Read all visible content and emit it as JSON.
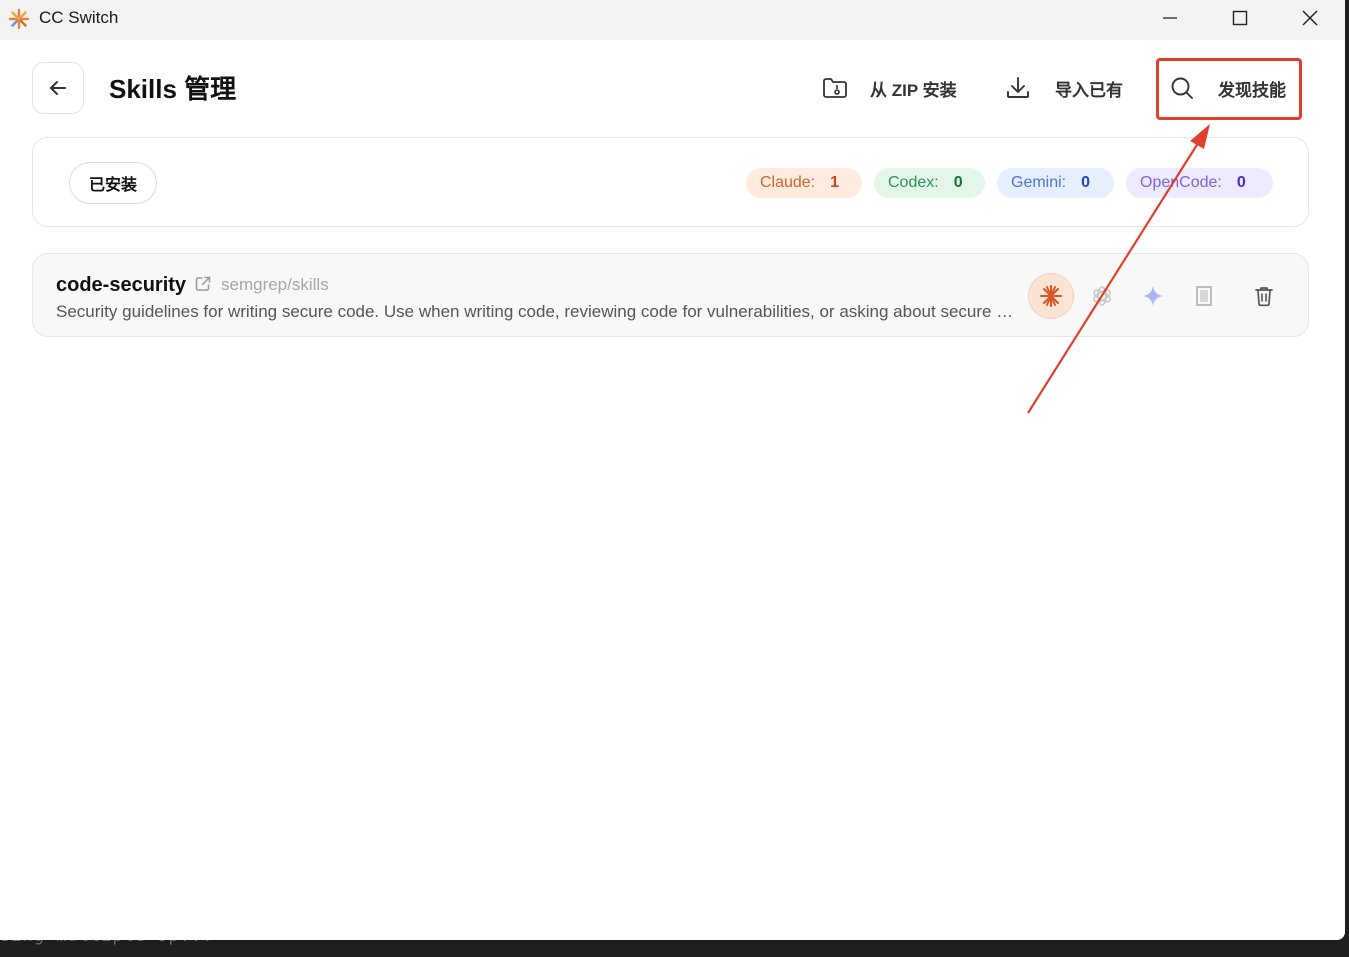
{
  "window": {
    "title": "CC Switch"
  },
  "header": {
    "title": "Skills 管理",
    "zip_install_label": "从 ZIP 安装",
    "import_label": "导入已有",
    "discover_label": "发现技能"
  },
  "filter": {
    "installed_label": "已安装",
    "counts": [
      {
        "name": "Claude:",
        "value": "1"
      },
      {
        "name": "Codex:",
        "value": "0"
      },
      {
        "name": "Gemini:",
        "value": "0"
      },
      {
        "name": "OpenCode:",
        "value": "0"
      }
    ]
  },
  "skills": [
    {
      "name": "code-security",
      "source": "semgrep/skills",
      "description": "Security guidelines for writing secure code. Use when writing code, reviewing code for vulnerabilities, or asking about secure coding practices"
    }
  ],
  "background_terminal_text": "sing multiple sp...",
  "colors": {
    "highlight": "#e0402a",
    "claude": "#d2622c",
    "codex": "#2d9455",
    "gemini": "#4c74d9",
    "opencode": "#7c62e0"
  },
  "icons": {
    "app_logo": "starburst-logo-icon",
    "back": "arrow-left-icon",
    "zip": "folder-zip-icon",
    "import": "download-icon",
    "discover": "search-icon",
    "external": "external-link-icon",
    "claude": "claude-icon",
    "codex": "openai-icon",
    "gemini": "gemini-sparkle-icon",
    "opencode": "opencode-icon",
    "delete": "trash-icon"
  }
}
